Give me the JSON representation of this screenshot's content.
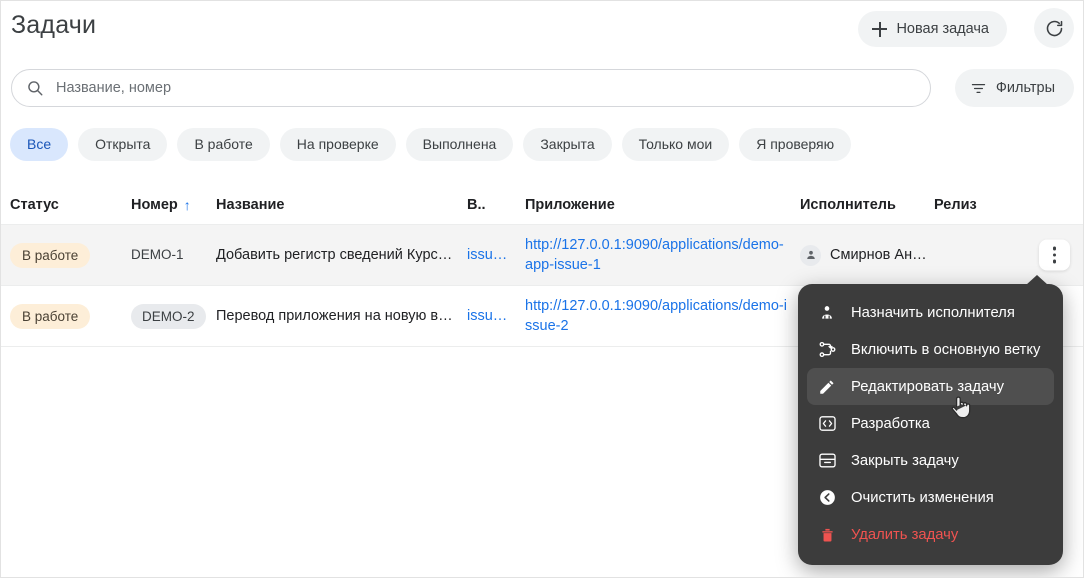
{
  "header": {
    "title": "Задачи",
    "new_task_label": "Новая задача",
    "new_task_icon": "plus-icon",
    "refresh_icon": "refresh-icon"
  },
  "search": {
    "placeholder": "Название, номер",
    "value": "",
    "icon": "search-icon",
    "filters_label": "Фильтры",
    "filters_icon": "filter-icon"
  },
  "chips": [
    {
      "label": "Все",
      "selected": true
    },
    {
      "label": "Открыта",
      "selected": false
    },
    {
      "label": "В работе",
      "selected": false
    },
    {
      "label": "На проверке",
      "selected": false
    },
    {
      "label": "Выполнена",
      "selected": false
    },
    {
      "label": "Закрыта",
      "selected": false
    },
    {
      "label": "Только мои",
      "selected": false
    },
    {
      "label": "Я проверяю",
      "selected": false
    }
  ],
  "table": {
    "columns": {
      "status": "Статус",
      "number": "Номер",
      "number_sort": "↑",
      "name": "Название",
      "version": "В..",
      "application": "Приложение",
      "assignee": "Исполнитель",
      "release": "Релиз"
    },
    "rows": [
      {
        "status": "В работе",
        "number": "DEMO-1",
        "name": "Добавить регистр сведений Курс…",
        "version": "issu…",
        "application": "http://127.0.0.1:9090/applications/demo-app-issue-1",
        "assignee": "Смирнов Ан…",
        "release": ""
      },
      {
        "status": "В работе",
        "number": "DEMO-2",
        "name": "Перевод приложения на новую в…",
        "version": "issu…",
        "application": "http://127.0.0.1:9090/applications/demo-issue-2",
        "assignee": "",
        "release": ""
      }
    ]
  },
  "context_menu": {
    "items": [
      {
        "label": "Назначить исполнителя",
        "icon": "assign-user-icon",
        "danger": false,
        "highlighted": false
      },
      {
        "label": "Включить в основную ветку",
        "icon": "branch-merge-icon",
        "danger": false,
        "highlighted": false
      },
      {
        "label": "Редактировать задачу",
        "icon": "pencil-icon",
        "danger": false,
        "highlighted": true
      },
      {
        "label": "Разработка",
        "icon": "code-icon",
        "danger": false,
        "highlighted": false
      },
      {
        "label": "Закрыть задачу",
        "icon": "archive-icon",
        "danger": false,
        "highlighted": false
      },
      {
        "label": "Очистить изменения",
        "icon": "revert-arrow-icon",
        "danger": false,
        "highlighted": false
      },
      {
        "label": "Удалить задачу",
        "icon": "trash-icon",
        "danger": true,
        "highlighted": false
      }
    ]
  },
  "colors": {
    "accent_link": "#1a73e8",
    "chip_selected_bg": "#d9e7fd",
    "badge_bg": "#fdeed8",
    "menu_bg": "#3c3c3c",
    "danger": "#ef5350"
  }
}
